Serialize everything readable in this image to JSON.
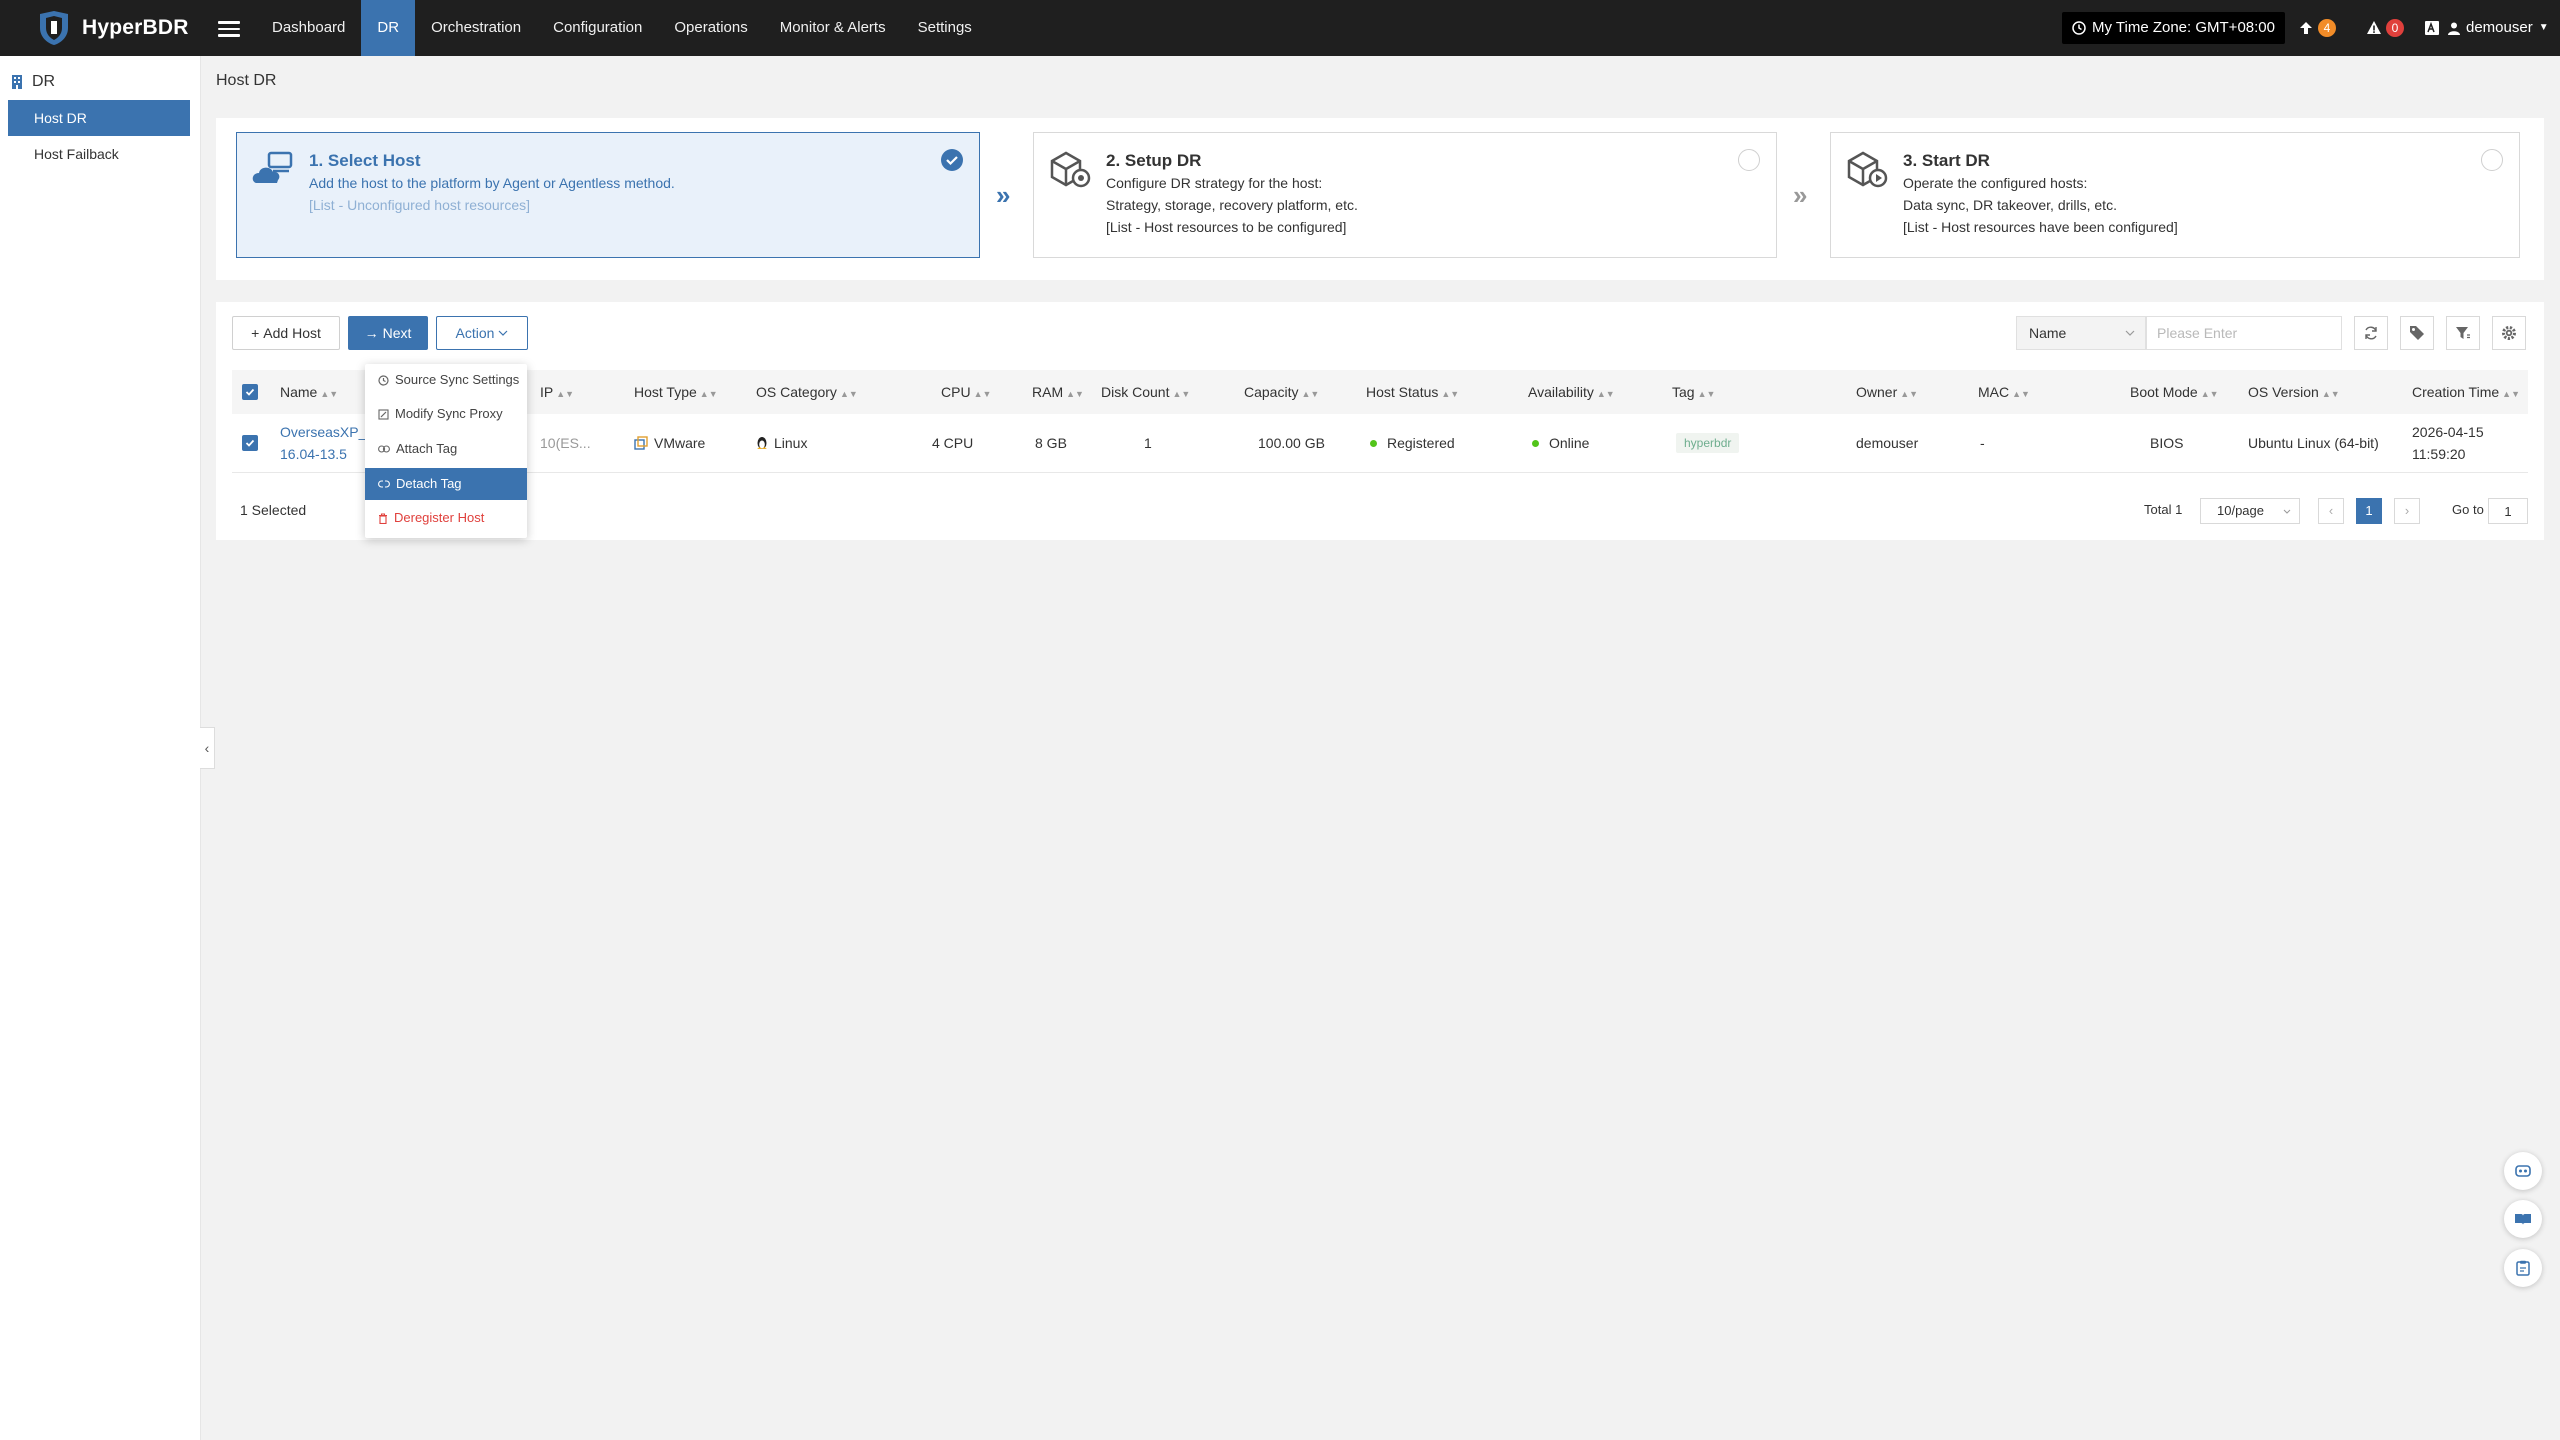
{
  "app": {
    "name": "HyperBDR"
  },
  "nav": [
    "Dashboard",
    "DR",
    "Orchestration",
    "Configuration",
    "Operations",
    "Monitor & Alerts",
    "Settings"
  ],
  "header": {
    "timezone": "My Time Zone: GMT+08:00",
    "task_count": "4",
    "alert_count": "0",
    "user": "demouser"
  },
  "sidebar": {
    "section": "DR",
    "items": [
      "Host DR",
      "Host Failback"
    ]
  },
  "page": {
    "title": "Host DR"
  },
  "steps": [
    {
      "title": "1. Select Host",
      "line1": "Add the host to the platform by Agent or Agentless method.",
      "line2": "[List - Unconfigured host resources]",
      "line3": ""
    },
    {
      "title": "2. Setup DR",
      "line1": "Configure DR strategy for the host:",
      "line2": "Strategy, storage, recovery platform, etc.",
      "line3": "[List - Host resources to be configured]"
    },
    {
      "title": "3. Start DR",
      "line1": "Operate the configured hosts:",
      "line2": "Data sync, DR takeover, drills, etc.",
      "line3": "[List - Host resources have been configured]"
    }
  ],
  "toolbar": {
    "add_host": "Add Host",
    "next": "Next",
    "action": "Action",
    "search_field": "Name",
    "search_placeholder": "Please Enter"
  },
  "action_menu": [
    "Source Sync Settings",
    "Modify Sync Proxy",
    "Attach Tag",
    "Detach Tag",
    "Deregister Host"
  ],
  "table": {
    "columns": [
      "Name",
      "IP",
      "Host Type",
      "OS Category",
      "CPU",
      "RAM",
      "Disk Count",
      "Capacity",
      "Host Status",
      "Availability",
      "Tag",
      "Owner",
      "MAC",
      "Boot Mode",
      "OS Version",
      "Creation Time"
    ],
    "rows": [
      {
        "name_l1": "OverseasXP_",
        "name_l2": "16.04-13.5",
        "ip": "10(ES...",
        "host_type": "VMware",
        "os_category": "Linux",
        "cpu": "4 CPU",
        "ram": "8 GB",
        "disk_count": "1",
        "capacity": "100.00 GB",
        "host_status": "Registered",
        "availability": "Online",
        "tag": "hyperbdr",
        "owner": "demouser",
        "mac": "-",
        "boot_mode": "BIOS",
        "os_version": "Ubuntu Linux (64-bit)",
        "created_date": "2026-04-15",
        "created_time": "11:59:20"
      }
    ]
  },
  "footer": {
    "selected": "1 Selected",
    "total": "Total 1",
    "page_size": "10/page",
    "current_page": "1",
    "goto_label": "Go to",
    "goto_value": "1"
  },
  "colors": {
    "primary": "#3b73af",
    "topbar": "#1f1f1f",
    "success": "#52c41a",
    "danger": "#e0403c",
    "task_badge": "#f28c28",
    "alert_badge": "#e0403c"
  }
}
